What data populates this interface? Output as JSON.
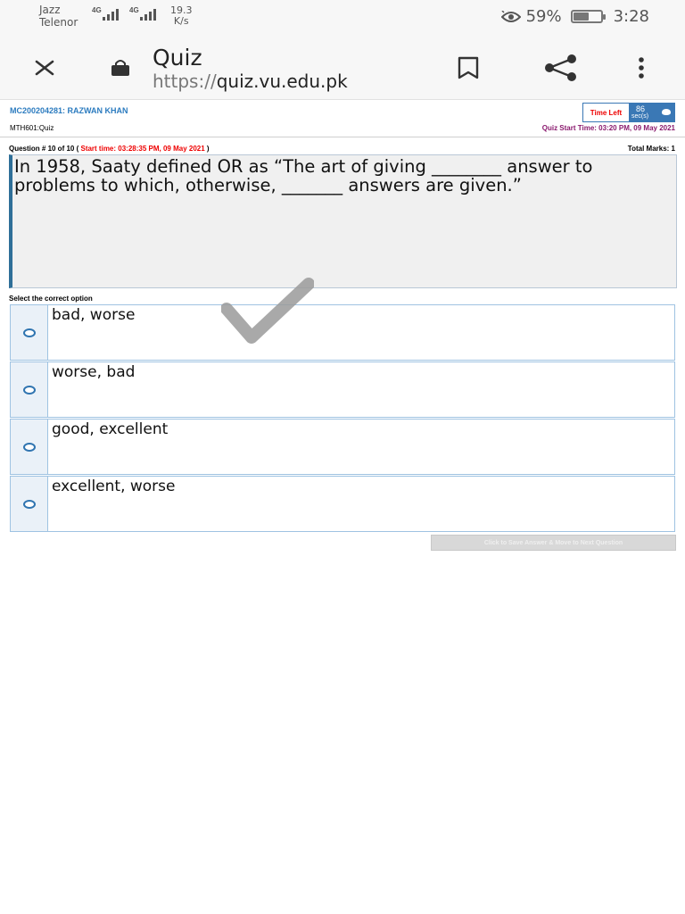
{
  "status_bar": {
    "carrier_1": "Jazz",
    "carrier_2": "Telenor",
    "network_1": "4G",
    "network_2": "4G",
    "speed_value": "19.3",
    "speed_unit": "K/s",
    "battery_percent": "59%",
    "battery_level": 0.59,
    "clock": "3:28"
  },
  "browser": {
    "page_title": "Quiz",
    "url_scheme": "https://",
    "url_host": "quiz.vu.edu.pk",
    "icons": [
      "close-icon",
      "lock-icon",
      "bookmark-icon",
      "share-icon",
      "more-vert-icon"
    ]
  },
  "quiz": {
    "student": "MC200204281: RAZWAN KHAN",
    "course": "MTH601:Quiz",
    "time_left_label": "Time Left",
    "time_left_value": "86",
    "time_left_unit": "sec(s)",
    "quiz_start": "Quiz Start Time: 03:20 PM, 09 May 2021",
    "question_number": "Question # 10 of 10 (",
    "question_start": "Start time: 03:28:35 PM, 09 May 2021",
    "question_close": ")",
    "total_marks": "Total Marks: 1",
    "question_text": "In 1958, Saaty defined OR as “The art of giving ________ answer to problems to which, otherwise, _______ answers are given.”",
    "select_label": "Select the correct option",
    "options": [
      {
        "text": "bad, worse"
      },
      {
        "text": "worse, bad"
      },
      {
        "text": "good, excellent"
      },
      {
        "text": "excellent, worse"
      }
    ],
    "next_button": "Click to Save Answer & Move to Next Question"
  }
}
